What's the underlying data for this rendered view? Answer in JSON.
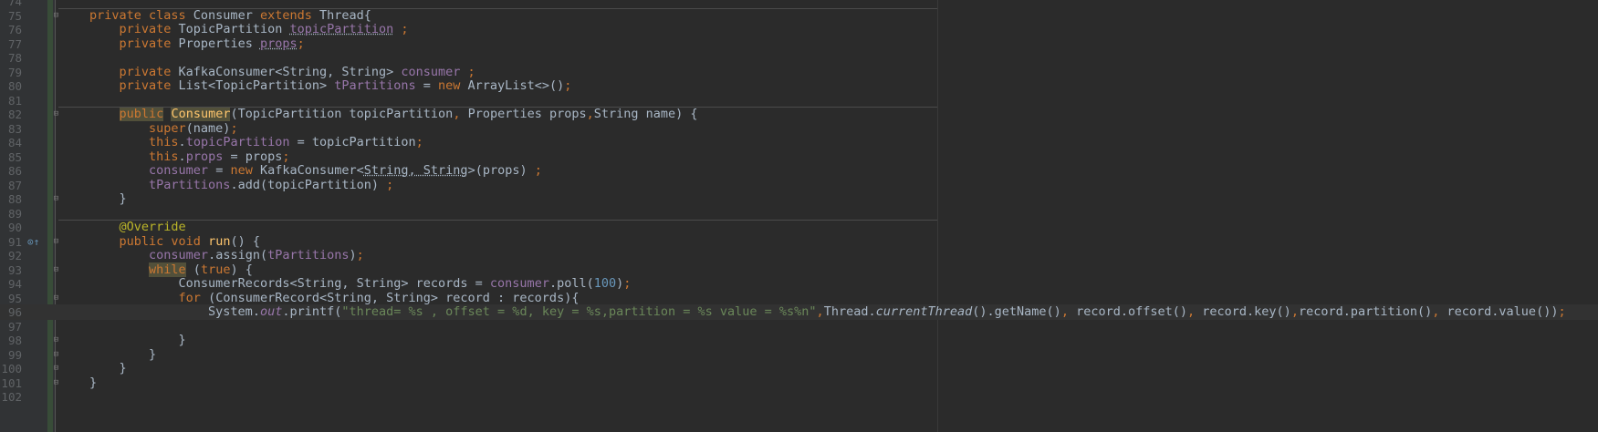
{
  "editor": {
    "lines": [
      {
        "n": "74",
        "tokens": []
      },
      {
        "n": "75",
        "fold": "⊟",
        "sep": true,
        "tokens": [
          {
            "t": "private class ",
            "c": "kw"
          },
          {
            "t": "Consumer "
          },
          {
            "t": "extends ",
            "c": "kw"
          },
          {
            "t": "Thread{"
          }
        ]
      },
      {
        "n": "76",
        "tokens": [
          {
            "t": "    "
          },
          {
            "t": "private ",
            "c": "kw"
          },
          {
            "t": "TopicPartition "
          },
          {
            "t": "topicPartition",
            "c": "fld warn"
          },
          {
            "t": " ;",
            "c": "kw"
          }
        ]
      },
      {
        "n": "77",
        "tokens": [
          {
            "t": "    "
          },
          {
            "t": "private ",
            "c": "kw"
          },
          {
            "t": "Properties "
          },
          {
            "t": "props",
            "c": "fld warn"
          },
          {
            "t": ";",
            "c": "kw"
          }
        ]
      },
      {
        "n": "78",
        "tokens": []
      },
      {
        "n": "79",
        "tokens": [
          {
            "t": "    "
          },
          {
            "t": "private ",
            "c": "kw"
          },
          {
            "t": "KafkaConsumer<String, String> "
          },
          {
            "t": "consumer",
            "c": "fld"
          },
          {
            "t": " ;",
            "c": "kw"
          }
        ]
      },
      {
        "n": "80",
        "tokens": [
          {
            "t": "    "
          },
          {
            "t": "private ",
            "c": "kw"
          },
          {
            "t": "List<TopicPartition> "
          },
          {
            "t": "tPartitions",
            "c": "fld"
          },
          {
            "t": " = "
          },
          {
            "t": "new ",
            "c": "kw"
          },
          {
            "t": "ArrayList<>()"
          },
          {
            "t": ";",
            "c": "kw"
          }
        ]
      },
      {
        "n": "81",
        "tokens": []
      },
      {
        "n": "82",
        "fold": "⊟",
        "sep": true,
        "tokens": [
          {
            "t": "    "
          },
          {
            "t": "public",
            "c": "kw hl"
          },
          {
            "t": " "
          },
          {
            "t": "Consumer",
            "c": "mth hl"
          },
          {
            "t": "(TopicPartition topicPartition"
          },
          {
            "t": ", ",
            "c": "kw"
          },
          {
            "t": "Properties props"
          },
          {
            "t": ",",
            "c": "kw"
          },
          {
            "t": "String name) {"
          }
        ]
      },
      {
        "n": "83",
        "tokens": [
          {
            "t": "        "
          },
          {
            "t": "super",
            "c": "kw"
          },
          {
            "t": "(name)"
          },
          {
            "t": ";",
            "c": "kw"
          }
        ]
      },
      {
        "n": "84",
        "tokens": [
          {
            "t": "        "
          },
          {
            "t": "this",
            "c": "kw"
          },
          {
            "t": "."
          },
          {
            "t": "topicPartition",
            "c": "fld"
          },
          {
            "t": " = topicPartition"
          },
          {
            "t": ";",
            "c": "kw"
          }
        ]
      },
      {
        "n": "85",
        "tokens": [
          {
            "t": "        "
          },
          {
            "t": "this",
            "c": "kw"
          },
          {
            "t": "."
          },
          {
            "t": "props",
            "c": "fld"
          },
          {
            "t": " = props"
          },
          {
            "t": ";",
            "c": "kw"
          }
        ]
      },
      {
        "n": "86",
        "tokens": [
          {
            "t": "        "
          },
          {
            "t": "consumer",
            "c": "fld"
          },
          {
            "t": " = "
          },
          {
            "t": "new ",
            "c": "kw"
          },
          {
            "t": "KafkaConsumer<"
          },
          {
            "t": "String, String",
            "c": "warn"
          },
          {
            "t": ">(props) "
          },
          {
            "t": ";",
            "c": "kw"
          }
        ]
      },
      {
        "n": "87",
        "tokens": [
          {
            "t": "        "
          },
          {
            "t": "tPartitions",
            "c": "fld"
          },
          {
            "t": ".add(topicPartition) "
          },
          {
            "t": ";",
            "c": "kw"
          }
        ]
      },
      {
        "n": "88",
        "fold": "⊟",
        "tokens": [
          {
            "t": "    }"
          }
        ]
      },
      {
        "n": "89",
        "tokens": []
      },
      {
        "n": "90",
        "sep": true,
        "tokens": [
          {
            "t": "    "
          },
          {
            "t": "@Override",
            "c": "ann"
          }
        ]
      },
      {
        "n": "91",
        "fold": "⊟",
        "marker": "⊙↑",
        "tokens": [
          {
            "t": "    "
          },
          {
            "t": "public void ",
            "c": "kw"
          },
          {
            "t": "run",
            "c": "mth"
          },
          {
            "t": "() {"
          }
        ]
      },
      {
        "n": "92",
        "tokens": [
          {
            "t": "        "
          },
          {
            "t": "consumer",
            "c": "fld"
          },
          {
            "t": ".assign("
          },
          {
            "t": "tPartitions",
            "c": "fld"
          },
          {
            "t": ")"
          },
          {
            "t": ";",
            "c": "kw"
          }
        ]
      },
      {
        "n": "93",
        "fold": "⊟",
        "tokens": [
          {
            "t": "        "
          },
          {
            "t": "while",
            "c": "kw hl"
          },
          {
            "t": " ("
          },
          {
            "t": "true",
            "c": "kw"
          },
          {
            "t": ") {"
          }
        ]
      },
      {
        "n": "94",
        "tokens": [
          {
            "t": "            "
          },
          {
            "t": "ConsumerRecords<String, String> records = "
          },
          {
            "t": "consumer",
            "c": "fld"
          },
          {
            "t": ".poll("
          },
          {
            "t": "100",
            "c": "num"
          },
          {
            "t": ")"
          },
          {
            "t": ";",
            "c": "kw"
          }
        ]
      },
      {
        "n": "95",
        "fold": "⊟",
        "tokens": [
          {
            "t": "            "
          },
          {
            "t": "for ",
            "c": "kw"
          },
          {
            "t": "(ConsumerRecord<String, String> record : records){"
          }
        ]
      },
      {
        "n": "96",
        "current": true,
        "tokens": [
          {
            "t": "                "
          },
          {
            "t": "System."
          },
          {
            "t": "out",
            "c": "fld ital"
          },
          {
            "t": ".printf("
          },
          {
            "t": "\"thread= %s , offset = %d, key = %s,partition = %s value = %s%n\"",
            "c": "str"
          },
          {
            "t": ",",
            "c": "kw"
          },
          {
            "t": "Thread."
          },
          {
            "t": "currentThread",
            "c": "ital"
          },
          {
            "t": "().getName()"
          },
          {
            "t": ", ",
            "c": "kw"
          },
          {
            "t": "record.offset()"
          },
          {
            "t": ", ",
            "c": "kw"
          },
          {
            "t": "record.key()"
          },
          {
            "t": ",",
            "c": "kw"
          },
          {
            "t": "record.partition()"
          },
          {
            "t": ", ",
            "c": "kw"
          },
          {
            "t": "record.value())"
          },
          {
            "t": ";",
            "c": "kw"
          }
        ]
      },
      {
        "n": "97",
        "tokens": []
      },
      {
        "n": "98",
        "fold": "⊟",
        "tokens": [
          {
            "t": "            }"
          }
        ]
      },
      {
        "n": "99",
        "fold": "⊟",
        "tokens": [
          {
            "t": "        }"
          }
        ]
      },
      {
        "n": "100",
        "fold": "⊟",
        "tokens": [
          {
            "t": "    }"
          }
        ]
      },
      {
        "n": "101",
        "fold": "⊟",
        "tokens": [
          {
            "t": "}"
          }
        ]
      },
      {
        "n": "102",
        "tokens": []
      }
    ]
  }
}
